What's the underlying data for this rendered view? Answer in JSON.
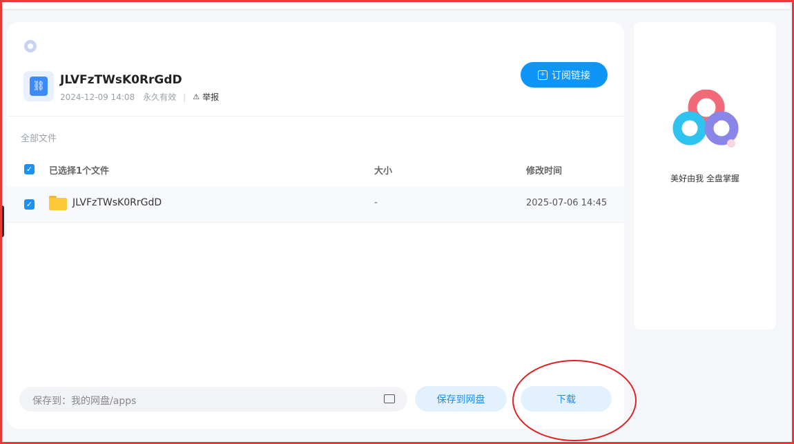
{
  "share": {
    "title": "JLVFzTWsK0RrGdD",
    "date": "2024-12-09 14:08",
    "validity": "永久有效",
    "report": "举报",
    "subscribe": "订阅链接"
  },
  "breadcrumb": "全部文件",
  "table": {
    "selected_label": "已选择1个文件",
    "col_size": "大小",
    "col_modified": "修改时间",
    "rows": [
      {
        "name": "JLVFzTWsK0RrGdD",
        "size": "-",
        "modified": "2025-07-06 14:45"
      }
    ]
  },
  "footer": {
    "save_path": "保存到：我的网盘/apps",
    "save_button": "保存到网盘",
    "download_button": "下载"
  },
  "sidebar": {
    "slogan": "美好由我  全盘掌握"
  },
  "colors": {
    "accent": "#0f95f7",
    "annotation": "#e02020",
    "frame": "#e83a3a"
  }
}
